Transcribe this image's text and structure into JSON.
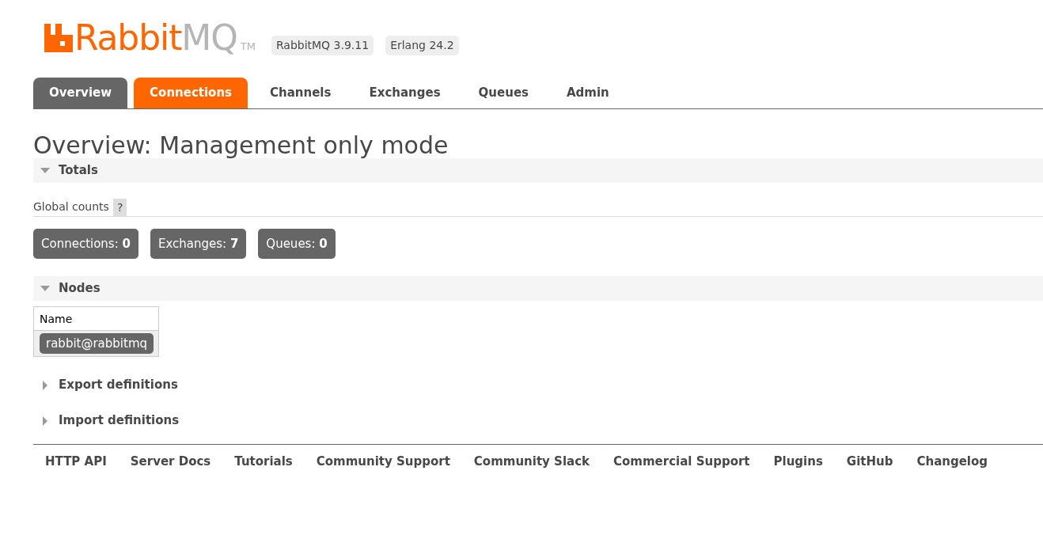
{
  "logo": {
    "primary": "Rabbit",
    "secondary": "MQ",
    "trademark": "TM"
  },
  "versions": [
    "RabbitMQ 3.9.11",
    "Erlang 24.2"
  ],
  "tabs": [
    {
      "label": "Overview",
      "selected": true,
      "highlighted": false
    },
    {
      "label": "Connections",
      "selected": false,
      "highlighted": true
    },
    {
      "label": "Channels",
      "selected": false,
      "highlighted": false
    },
    {
      "label": "Exchanges",
      "selected": false,
      "highlighted": false
    },
    {
      "label": "Queues",
      "selected": false,
      "highlighted": false
    },
    {
      "label": "Admin",
      "selected": false,
      "highlighted": false
    }
  ],
  "page_title": "Overview: Management only mode",
  "totals": {
    "title": "Totals",
    "expanded": true,
    "global_counts_label": "Global counts",
    "help": "?",
    "counts": [
      "Connections: **0**",
      "Exchanges: **7**",
      "Queues: **0**"
    ]
  },
  "nodes": {
    "title": "Nodes",
    "expanded": true,
    "column": "Name",
    "rows": [
      "rabbit@rabbitmq"
    ]
  },
  "sections": [
    {
      "title": "Export definitions",
      "expanded": false
    },
    {
      "title": "Import definitions",
      "expanded": false
    }
  ],
  "footer_links": [
    "HTTP API",
    "Server Docs",
    "Tutorials",
    "Community Support",
    "Community Slack",
    "Commercial Support",
    "Plugins",
    "GitHub",
    "Changelog"
  ]
}
